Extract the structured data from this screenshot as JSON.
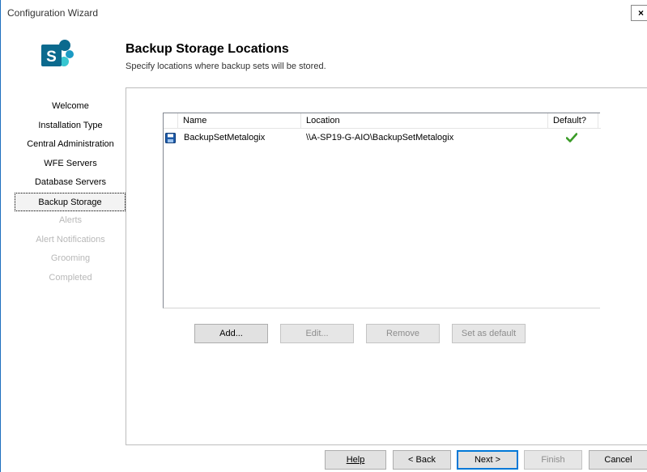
{
  "window": {
    "title": "Configuration Wizard",
    "close_label": "×"
  },
  "header": {
    "title": "Backup Storage Locations",
    "subtitle": "Specify locations where backup sets will be stored."
  },
  "nav": {
    "items": [
      {
        "label": "Welcome",
        "state": "normal"
      },
      {
        "label": "Installation Type",
        "state": "normal"
      },
      {
        "label": "Central Administration",
        "state": "normal"
      },
      {
        "label": "WFE Servers",
        "state": "normal"
      },
      {
        "label": "Database Servers",
        "state": "normal"
      },
      {
        "label": "Backup Storage",
        "state": "active"
      },
      {
        "label": "Alerts",
        "state": "disabled"
      },
      {
        "label": "Alert Notifications",
        "state": "disabled"
      },
      {
        "label": "Grooming",
        "state": "disabled"
      },
      {
        "label": "Completed",
        "state": "disabled"
      }
    ]
  },
  "table": {
    "columns": [
      "Name",
      "Location",
      "Default?"
    ],
    "rows": [
      {
        "name": "BackupSetMetalogix",
        "location": "\\\\A-SP19-G-AIO\\BackupSetMetalogix",
        "default": true
      }
    ]
  },
  "actions": {
    "add": "Add...",
    "edit": "Edit...",
    "remove": "Remove",
    "set_default": "Set as default"
  },
  "footer": {
    "help": "Help",
    "back": "< Back",
    "next": "Next >",
    "finish": "Finish",
    "cancel": "Cancel"
  },
  "colors": {
    "accent": "#0078d7",
    "check": "#3a9b27",
    "disabled_text": "#b8b8b8"
  }
}
